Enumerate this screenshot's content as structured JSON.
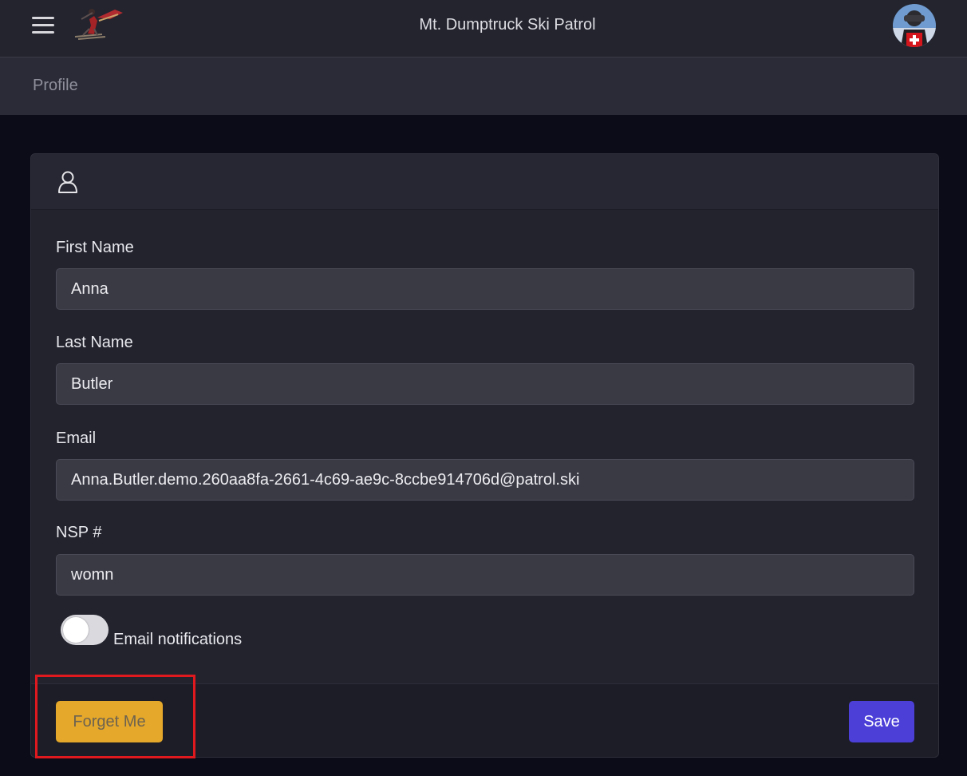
{
  "header": {
    "app_title": "Mt. Dumptruck Ski Patrol",
    "menu_icon": "hamburger-menu-icon",
    "logo": "ski-patroller-logo",
    "avatar": "user-avatar"
  },
  "page": {
    "title": "Profile"
  },
  "card": {
    "header_icon": "person-icon",
    "fields": {
      "first_name": {
        "label": "First Name",
        "value": "Anna"
      },
      "last_name": {
        "label": "Last Name",
        "value": "Butler"
      },
      "email": {
        "label": "Email",
        "value": "Anna.Butler.demo.260aa8fa-2661-4c69-ae9c-8ccbe914706d@patrol.ski"
      },
      "nsp": {
        "label": "NSP #",
        "value": "womn"
      }
    },
    "email_notifications": {
      "label": "Email notifications",
      "enabled": false
    }
  },
  "footer": {
    "forget_label": "Forget Me",
    "save_label": "Save"
  },
  "colors": {
    "forget_button": "#e5a82a",
    "save_button": "#4b3fd8",
    "highlight": "#e0191f",
    "background": "#0b0c18"
  }
}
